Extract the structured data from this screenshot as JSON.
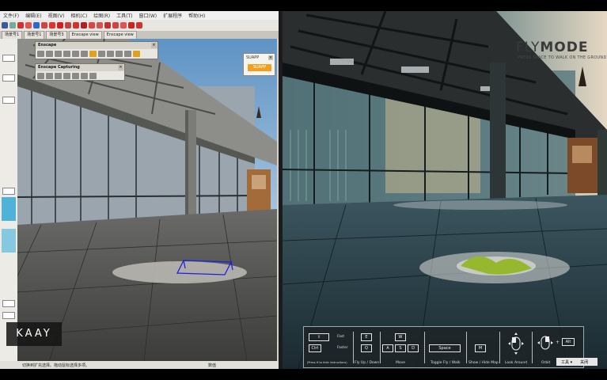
{
  "sketchup": {
    "menu": [
      "文件(F)",
      "编辑(E)",
      "视图(V)",
      "相机(C)",
      "绘图(R)",
      "工具(T)",
      "窗口(W)",
      "扩展程序",
      "帮助(H)"
    ],
    "tabs": [
      "场景号1",
      "场景号1",
      "场景号3",
      "Enscape view",
      "Enscape view"
    ],
    "status_hint": "切换到扩充选择。拖动鼠标选择多项。",
    "status_value_label": "数值",
    "enscape_toolbar_title": "Enscape",
    "capturing_toolbar_title": "Enscape Capturing",
    "suapp_title": "SUAPP",
    "suapp_button": "SUAPP",
    "close_glyph": "×"
  },
  "render": {
    "mode_title_light": "FLY",
    "mode_title_bold": "MODE",
    "mode_subtitle": "PRESS SPACE TO WALK ON THE GROUND",
    "controls": {
      "shift_key": "⇧",
      "ctrl_key": "Ctrl",
      "fast_label": "Fast",
      "faster_label": "Faster",
      "help_hint": "(Press H to hide instructions)",
      "e_key": "E",
      "q_key": "Q",
      "flyupdown_label": "Fly Up / Down",
      "w_key": "W",
      "a_key": "A",
      "s_key": "S",
      "d_key": "D",
      "move_label": "Move",
      "space_key": "Space",
      "toggle_label": "Toggle Fly / Walk",
      "m_key": "M",
      "showhide_label": "Show / Hide Map",
      "lookaround_label": "Look Around",
      "orbit_label": "Orbit",
      "plus": "+",
      "alt_key": "Alt"
    }
  },
  "brand": {
    "logo_text": "KAAY"
  },
  "tray": {
    "tools": "工具 ▾",
    "close": "关闭"
  },
  "colors": {
    "suapp_orange": "#f0a020",
    "sky": "#6f9fc9",
    "render_floor": "#2a4048"
  }
}
